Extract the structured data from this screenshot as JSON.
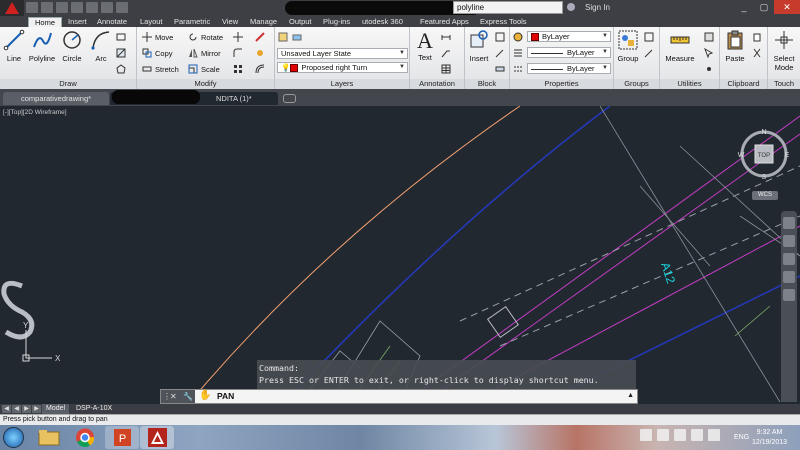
{
  "title_bar": {
    "search_value": "polyline",
    "sign_in_label": "Sign In",
    "window_controls": [
      "_",
      "▢",
      "✕"
    ]
  },
  "ribbon_tabs": [
    "Home",
    "Insert",
    "Annotate",
    "Layout",
    "Parametric",
    "View",
    "Manage",
    "Output",
    "Plug-ins",
    "utodesk 360",
    "Featured Apps",
    "Express Tools"
  ],
  "ribbon": {
    "draw": {
      "label": "Draw",
      "tools": [
        "Line",
        "Polyline",
        "Circle",
        "Arc"
      ]
    },
    "modify": {
      "label": "Modify",
      "tools": [
        "Move",
        "Rotate",
        "Copy",
        "Mirror",
        "Stretch",
        "Scale"
      ]
    },
    "layers": {
      "label": "Layers",
      "layer_state": "Unsaved Layer State",
      "current_layer": "Proposed right Turn"
    },
    "annotation": {
      "label": "Annotation",
      "text_label": "Text"
    },
    "block": {
      "label": "Block",
      "insert_label": "Insert"
    },
    "properties": {
      "label": "Properties",
      "color": "ByLayer",
      "linetype": "ByLayer",
      "lineweight": "ByLayer"
    },
    "groups": {
      "label": "Groups",
      "group_label": "Group"
    },
    "utilities": {
      "label": "Utilities",
      "measure_label": "Measure"
    },
    "clipboard": {
      "label": "Clipboard",
      "paste_label": "Paste"
    },
    "touch": {
      "label": "Touch",
      "select_mode_label": "Select Mode"
    }
  },
  "file_tabs": [
    "comparativedrawing*",
    "NDITA (1)*"
  ],
  "viewport": {
    "label": "[-][Top][2D Wireframe]",
    "viewcube": {
      "top": "TOP",
      "n": "N",
      "s": "S",
      "e": "E",
      "w": "W",
      "wcs": "WCS"
    },
    "annotation_text": "A12",
    "ucs": {
      "x": "X",
      "y": "Y"
    }
  },
  "command": {
    "history_line1": "Command:",
    "history_line2": "Press ESC or ENTER to exit, or right-click to display shortcut menu.",
    "current": "PAN"
  },
  "layout_tabs": [
    "Model",
    "DSP-A-10X"
  ],
  "status_bar": {
    "message": "Press pick button and drag to pan"
  },
  "taskbar": {
    "language": "ENG",
    "time": "9:32 AM",
    "date": "12/19/2013"
  },
  "colors": {
    "canvas": "#212830",
    "accent_magenta": "#c43cc4",
    "accent_blue": "#2438b8",
    "curve_orange": "#f4a070",
    "annotation_cyan": "#19d6e0"
  }
}
